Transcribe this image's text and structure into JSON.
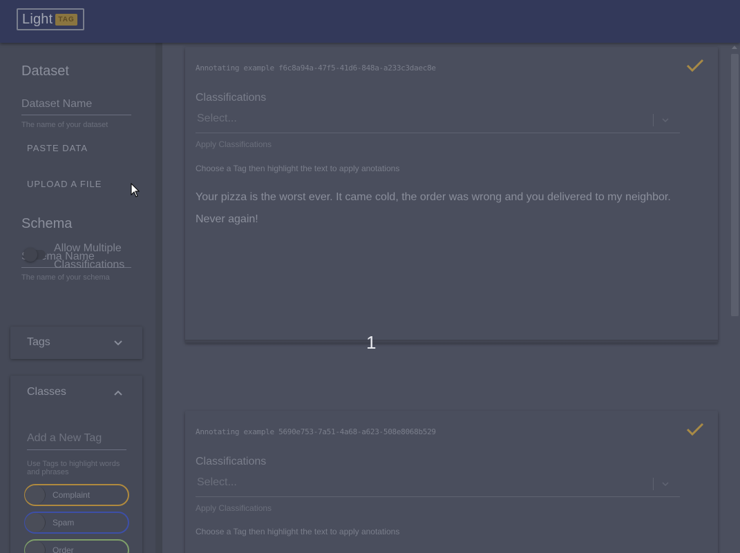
{
  "app": {
    "logo_text": "Light",
    "logo_badge": "TAG"
  },
  "sidebar": {
    "dataset": {
      "title": "Dataset",
      "name_field": "Dataset Name",
      "name_help": "The name of your dataset",
      "paste_button": "PASTE DATA",
      "upload_button": "UPLOAD A FILE"
    },
    "schema": {
      "title": "Schema",
      "name_field": "Schema Name",
      "name_help": "The name of your schema",
      "allow_multiple_label": "Allow Multiple Classifications",
      "allow_multiple": false
    },
    "tags_panel": {
      "title": "Tags",
      "expanded": false
    },
    "classes_panel": {
      "title": "Classes",
      "expanded": true,
      "new_tag_placeholder": "Add a New Tag",
      "help": "Use Tags to highlight words and phrases",
      "chips": [
        {
          "label": "Complaint",
          "color": "#b08a3e"
        },
        {
          "label": "Spam",
          "color": "#3d4fa8"
        },
        {
          "label": "Order",
          "color": "#7fa06a"
        }
      ]
    }
  },
  "examples": [
    {
      "id_text": "Annotating example f6c8a94a-47f5-41d6-848a-a233c3daec8e",
      "classifications_label": "Classifications",
      "select_placeholder": "Select...",
      "select_help": "Apply Classifications",
      "instructions": "Choose a Tag then highlight the text to apply anotations",
      "text": "Your pizza is the worst ever. It came cold, the order was wrong and you delivered to my neighbor. Never again!"
    },
    {
      "id_text": "Annotating example 5690e753-7a51-4a68-a623-508e8068b529",
      "classifications_label": "Classifications",
      "select_placeholder": "Select...",
      "select_help": "Apply Classifications",
      "instructions": "Choose a Tag then highlight the text to apply anotations"
    }
  ],
  "pagination": {
    "current_page": "1"
  },
  "colors": {
    "accent_check": "#a88a46",
    "topbar": "#33395a"
  }
}
